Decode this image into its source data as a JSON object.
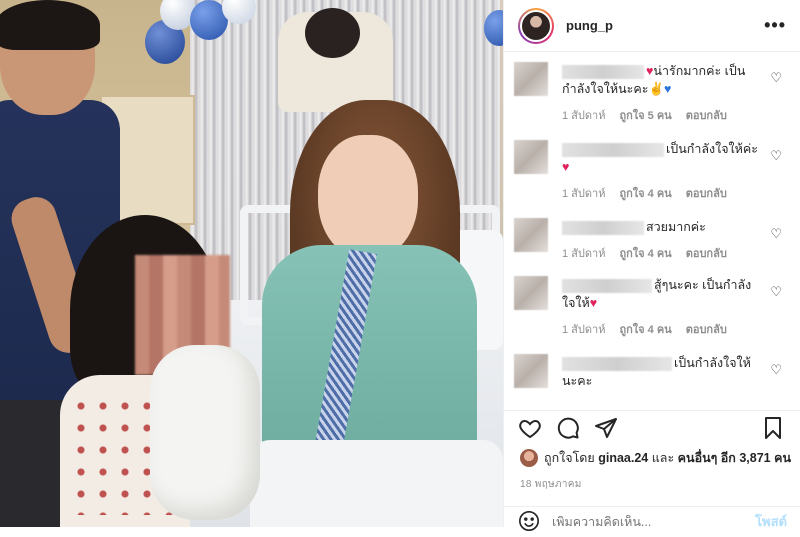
{
  "post": {
    "username": "pung_p",
    "more_label": "•••"
  },
  "comments": [
    {
      "text_before": "",
      "text": "น่ารักมากค่ะ เป็นกำลังใจให้นะคะ",
      "emojis": [
        "✌️"
      ],
      "hearts": [
        "red",
        "blue"
      ],
      "heart_leading": true,
      "time": "1 สัปดาห์",
      "likes": "ถูกใจ 5 คน",
      "reply": "ตอบกลับ"
    },
    {
      "text": "เป็นกำลังใจให้ค่ะ",
      "hearts": [
        "red"
      ],
      "time": "1 สัปดาห์",
      "likes": "ถูกใจ 4 คน",
      "reply": "ตอบกลับ"
    },
    {
      "text": "สวยมากค่ะ",
      "hearts": [],
      "time": "1 สัปดาห์",
      "likes": "ถูกใจ 4 คน",
      "reply": "ตอบกลับ"
    },
    {
      "text": "สู้ๆนะคะ เป็นกำลังใจให้",
      "hearts": [
        "red"
      ],
      "time": "1 สัปดาห์",
      "likes": "ถูกใจ 4 คน",
      "reply": "ตอบกลับ"
    },
    {
      "text": "เป็นกำลังใจให้นะคะ",
      "hearts": [],
      "time": "",
      "likes": "",
      "reply": ""
    }
  ],
  "likes_line": {
    "prefix": "ถูกใจโดย",
    "user": "ginaa.24",
    "middle": "และ",
    "others": "คนอื่นๆ อีก 3,871 คน"
  },
  "date": "18 พฤษภาคม",
  "add_comment": {
    "placeholder": "เพิ่มความคิดเห็น...",
    "post_label": "โพสต์"
  },
  "icons": {
    "like": "heart-outline-icon",
    "comment": "comment-bubble-icon",
    "share": "paper-plane-icon",
    "save": "bookmark-icon",
    "emoji": "smiley-icon"
  },
  "colors": {
    "heart_red": "#e0245e",
    "heart_blue": "#2d74d9",
    "post_button": "#b2dffc",
    "meta_gray": "#8e8e8e"
  }
}
